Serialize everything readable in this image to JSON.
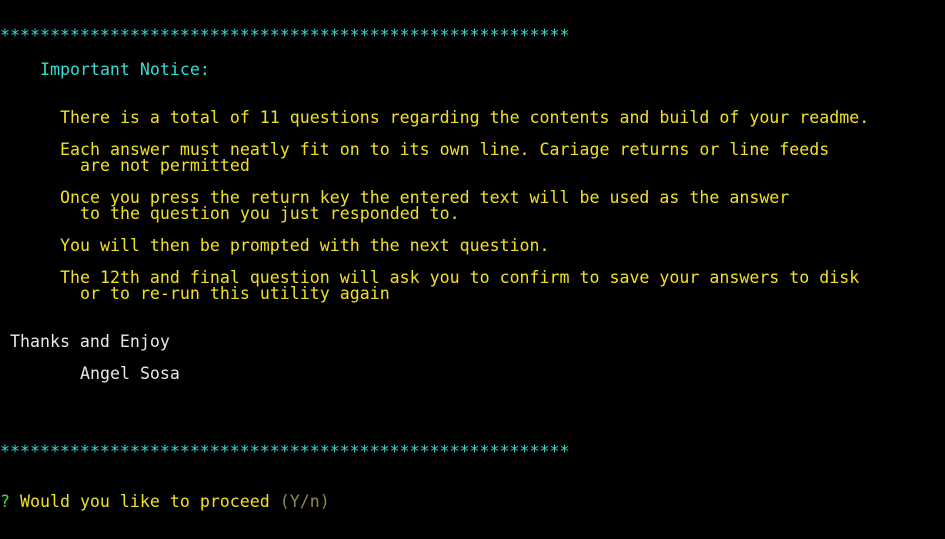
{
  "separator": "*********************************************************",
  "notice_heading": "Important Notice:",
  "notice_lines": [
    "There is a total of 11 questions regarding the contents and build of your readme.",
    "Each answer must neatly fit on to its own line. Cariage returns or line feeds",
    "are not permitted",
    "Once you press the return key the entered text will be used as the answer",
    "to the question you just responded to.",
    "You will then be prompted with the next question.",
    "The 12th and final question will ask you to confirm to save your answers to disk",
    "or to re-run this utility again"
  ],
  "thanks": "Thanks and Enjoy",
  "author": "Angel Sosa",
  "prompt": {
    "symbol": "?",
    "question": "Would you like to proceed",
    "hint": "(Y/n)"
  },
  "colors": {
    "background": "#000000",
    "separator": "#33ddd6",
    "heading": "#33ddd6",
    "body_text": "#f0e025",
    "thanks_text": "#e8e8e8",
    "prompt_symbol": "#3ddc3d",
    "hint": "#8c8a4c"
  }
}
